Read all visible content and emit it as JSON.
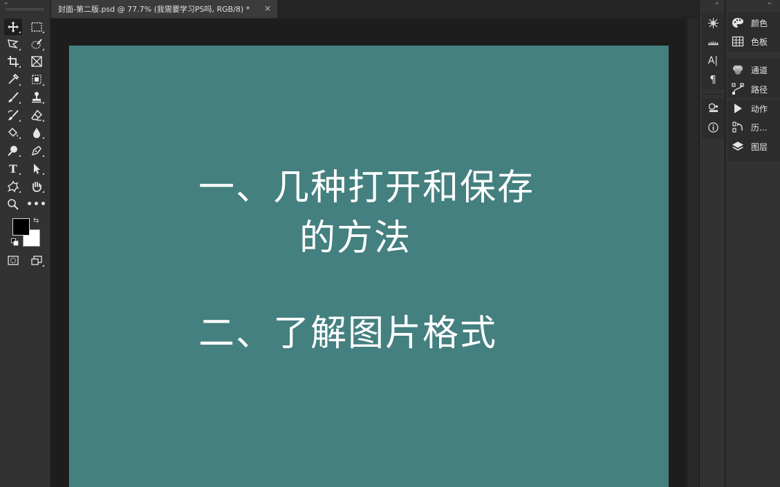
{
  "document": {
    "tab_title": "封面-第二版.psd @ 77.7% (我需要学习PS吗, RGB/8) *",
    "close_glyph": "×"
  },
  "canvas": {
    "background": "#44807f",
    "lines": [
      "一、几种打开和保存",
      "的方法",
      "二、了解图片格式"
    ]
  },
  "colors": {
    "foreground": "#000000",
    "background": "#ffffff"
  },
  "toolbar": {
    "collapse_glyph": "‹‹",
    "tools": [
      "move-tool",
      "rectangular-marquee-tool",
      "polygonal-lasso-tool",
      "quick-selection-tool",
      "crop-tool",
      "frame-tool",
      "eyedropper-tool",
      "object-selection-tool",
      "brush-tool",
      "clone-stamp-tool",
      "history-brush-tool",
      "eraser-tool",
      "paint-bucket-tool",
      "blur-tool",
      "dodge-tool",
      "pen-tool",
      "type-tool",
      "path-selection-tool",
      "custom-shape-tool",
      "hand-tool",
      "zoom-tool",
      "more-tools",
      "quick-mask-mode",
      "screen-mode"
    ],
    "type_glyph": "T",
    "more_glyph": "•••",
    "swap_glyph": "⇆"
  },
  "icon_panel": {
    "collapse_glyph": "‹‹",
    "icons": [
      "brush-settings-icon",
      "brush-presets-icon",
      "character-icon",
      "paragraph-icon",
      "libraries-icon",
      "info-icon"
    ],
    "character_glyph": "A|",
    "paragraph_glyph": "¶",
    "info_glyph": "i"
  },
  "right_panel": {
    "collapse_glyph": "‹‹",
    "items": [
      {
        "label": "颜色",
        "icon": "color-palette-icon"
      },
      {
        "label": "色板",
        "icon": "swatches-grid-icon"
      },
      {
        "label": "通道",
        "icon": "channels-icon"
      },
      {
        "label": "路径",
        "icon": "paths-icon"
      },
      {
        "label": "动作",
        "icon": "play-icon"
      },
      {
        "label": "历...",
        "icon": "history-icon"
      },
      {
        "label": "图层",
        "icon": "layers-icon"
      }
    ]
  }
}
